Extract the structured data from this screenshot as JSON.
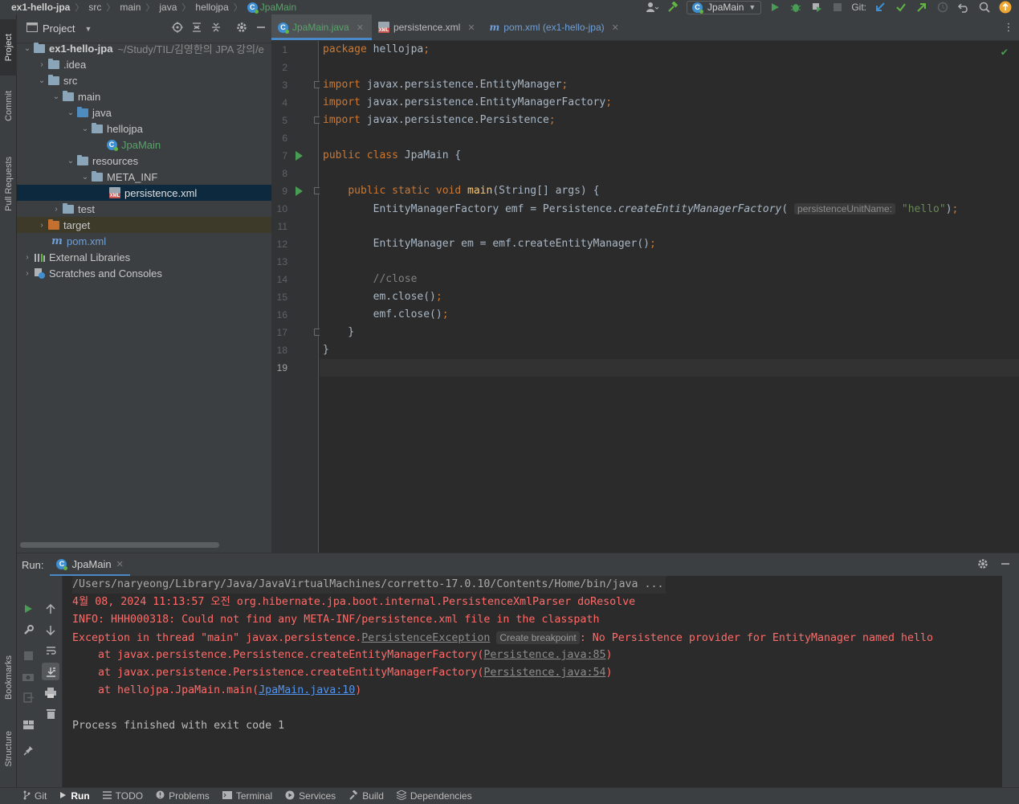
{
  "navbar": {
    "crumbs": [
      "ex1-hello-jpa",
      "src",
      "main",
      "java",
      "hellojpa"
    ],
    "current_class": "JpaMain",
    "run_config": "JpaMain",
    "git_label": "Git:"
  },
  "project_panel": {
    "title": "Project",
    "root": {
      "name": "ex1-hello-jpa",
      "path": "~/Study/TIL/김영한의 JPA 강의/e"
    },
    "items": [
      {
        "label": ".idea"
      },
      {
        "label": "src"
      },
      {
        "label": "main"
      },
      {
        "label": "java"
      },
      {
        "label": "hellojpa"
      },
      {
        "label": "JpaMain"
      },
      {
        "label": "resources"
      },
      {
        "label": "META_INF"
      },
      {
        "label": "persistence.xml"
      },
      {
        "label": "test"
      },
      {
        "label": "target"
      },
      {
        "label": "pom.xml"
      },
      {
        "label": "External Libraries"
      },
      {
        "label": "Scratches and Consoles"
      }
    ]
  },
  "left_strip": {
    "tabs": [
      "Project",
      "Commit",
      "Pull Requests",
      "Bookmarks",
      "Structure"
    ]
  },
  "editor": {
    "tabs": [
      {
        "label": "JpaMain.java",
        "active": true
      },
      {
        "label": "persistence.xml",
        "active": false
      },
      {
        "label": "pom.xml (ex1-hello-jpa)",
        "active": false
      }
    ],
    "line_numbers": [
      "1",
      "2",
      "3",
      "4",
      "5",
      "6",
      "7",
      "8",
      "9",
      "10",
      "11",
      "12",
      "13",
      "14",
      "15",
      "16",
      "17",
      "18",
      "19"
    ],
    "param_hint": "persistenceUnitName:",
    "string_literal": "\"hello\""
  },
  "run_panel": {
    "label": "Run:",
    "tab": "JpaMain",
    "console": {
      "line1": "/Users/naryeong/Library/Java/JavaVirtualMachines/corretto-17.0.10/Contents/Home/bin/java ...",
      "line2": "4월 08, 2024 11:13:57 오전 org.hibernate.jpa.boot.internal.PersistenceXmlParser doResolve",
      "line3": "INFO: HHH000318: Could not find any META-INF/persistence.xml file in the classpath",
      "line4_prefix": "Exception in thread \"main\" javax.persistence.",
      "line4_link": "PersistenceException",
      "line4_pill": "Create breakpoint",
      "line4_suffix": ": No Persistence provider for EntityManager named hello",
      "line5_prefix": "    at javax.persistence.Persistence.createEntityManagerFactory(",
      "line5_link": "Persistence.java:85",
      "line6_prefix": "    at javax.persistence.Persistence.createEntityManagerFactory(",
      "line6_link": "Persistence.java:54",
      "line7_prefix": "    at hellojpa.JpaMain.main(",
      "line7_link": "JpaMain.java:10",
      "close_paren": ")",
      "line9": "Process finished with exit code 1"
    }
  },
  "statusbar": {
    "items": [
      "Git",
      "Run",
      "TODO",
      "Problems",
      "Terminal",
      "Services",
      "Build",
      "Dependencies"
    ]
  },
  "colors": {
    "editor_bg": "#2b2b2b",
    "panel_bg": "#3c3f41",
    "keyword": "#cc7832",
    "error_text": "#ff6b68",
    "run_green": "#499c54",
    "selection": "#0d293e"
  }
}
